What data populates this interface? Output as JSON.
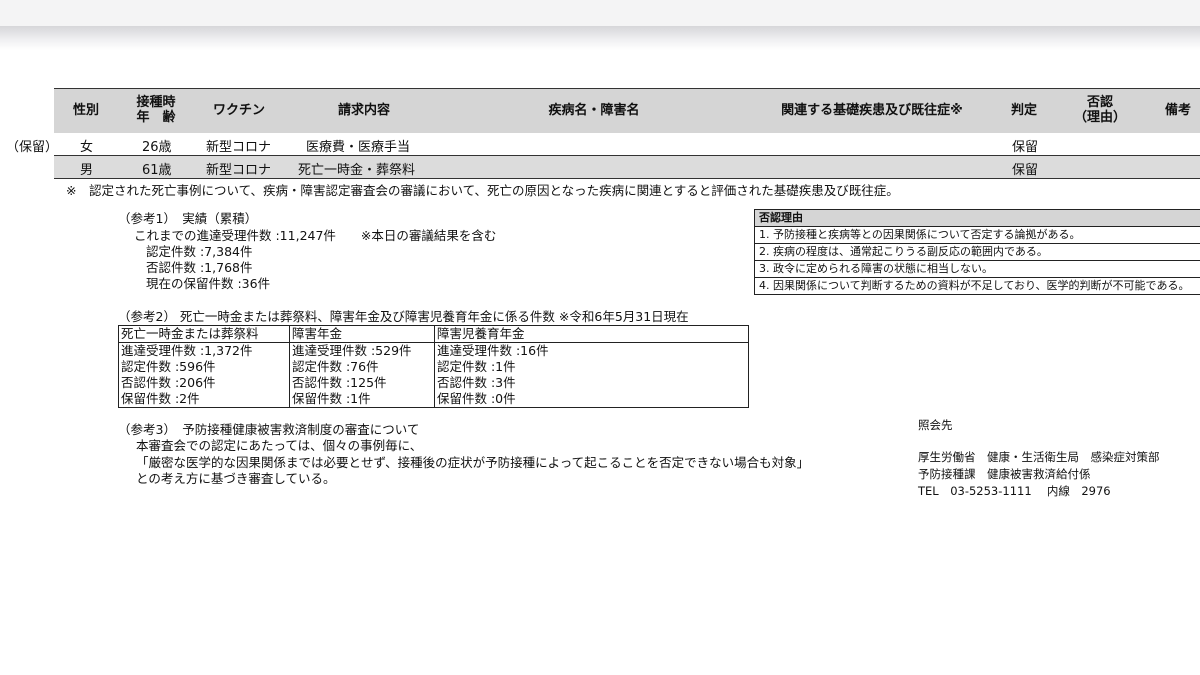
{
  "side_label": "（保留）",
  "table": {
    "headers": {
      "sex": "性別",
      "age_line1": "接種時",
      "age_line2": "年　齢",
      "vaccine": "ワクチン",
      "claim": "請求内容",
      "disease": "疾病名・障害名",
      "related": "関連する基礎疾患及び既往症※",
      "judgement": "判定",
      "denial_line1": "否認",
      "denial_line2": "（理由）",
      "remarks": "備考"
    },
    "rows": [
      {
        "sex": "女",
        "age": "26歳",
        "vaccine": "新型コロナ",
        "claim": "医療費・医療手当",
        "judgement": "保留"
      },
      {
        "sex": "男",
        "age": "61歳",
        "vaccine": "新型コロナ",
        "claim": "死亡一時金・葬祭料",
        "judgement": "保留"
      }
    ]
  },
  "footnote": "※　認定された死亡事例について、疾病・障害認定審査会の審議において、死亡の原因となった疾病に関連とすると評価された基礎疾患及び既往症。",
  "ref1": {
    "title": "（参考1）　実績（累積）",
    "line1": "これまでの進達受理件数 :11,247件　　※本日の審議結果を含む",
    "line2": "認定件数 :7,384件",
    "line3": "否認件数 :1,768件",
    "line4": "現在の保留件数 :36件"
  },
  "reasons": {
    "title": "否認理由",
    "items": [
      "1. 予防接種と疾病等との因果関係について否定する論拠がある。",
      "2. 疾病の程度は、通常起こりうる副反応の範囲内である。",
      "3. 政令に定められる障害の状態に相当しない。",
      "4. 因果関係について判断するための資料が不足しており、医学的判断が不可能である。"
    ]
  },
  "ref2": {
    "title": "（参考2） 死亡一時金または葬祭料、障害年金及び障害児養育年金に係る件数 ※令和6年5月31日現在",
    "columns": [
      {
        "header": "死亡一時金または葬祭料",
        "lines": [
          "進達受理件数 :1,372件",
          "認定件数 :596件",
          "否認件数 :206件",
          "保留件数 :2件"
        ]
      },
      {
        "header": "障害年金",
        "lines": [
          "進達受理件数 :529件",
          "認定件数 :76件",
          "否認件数 :125件",
          "保留件数 :1件"
        ]
      },
      {
        "header": "障害児養育年金",
        "lines": [
          "進達受理件数 :16件",
          "認定件数 :1件",
          "否認件数 :3件",
          "保留件数 :0件"
        ]
      }
    ]
  },
  "ref3": {
    "title": "（参考3）　予防接種健康被害救済制度の審査について",
    "line1": "本審査会での認定にあたっては、個々の事例毎に、",
    "line2": "「厳密な医学的な因果関係までは必要とせず、接種後の症状が予防接種によって起こることを否定できない場合も対象」",
    "line3": "との考え方に基づき審査している。"
  },
  "contact": {
    "title": "照会先",
    "line1": "厚生労働省　健康・生活衛生局　感染症対策部",
    "line2": "予防接種課　健康被害救済給付係",
    "line3": "TEL　03-5253-1111　 内線　2976"
  }
}
